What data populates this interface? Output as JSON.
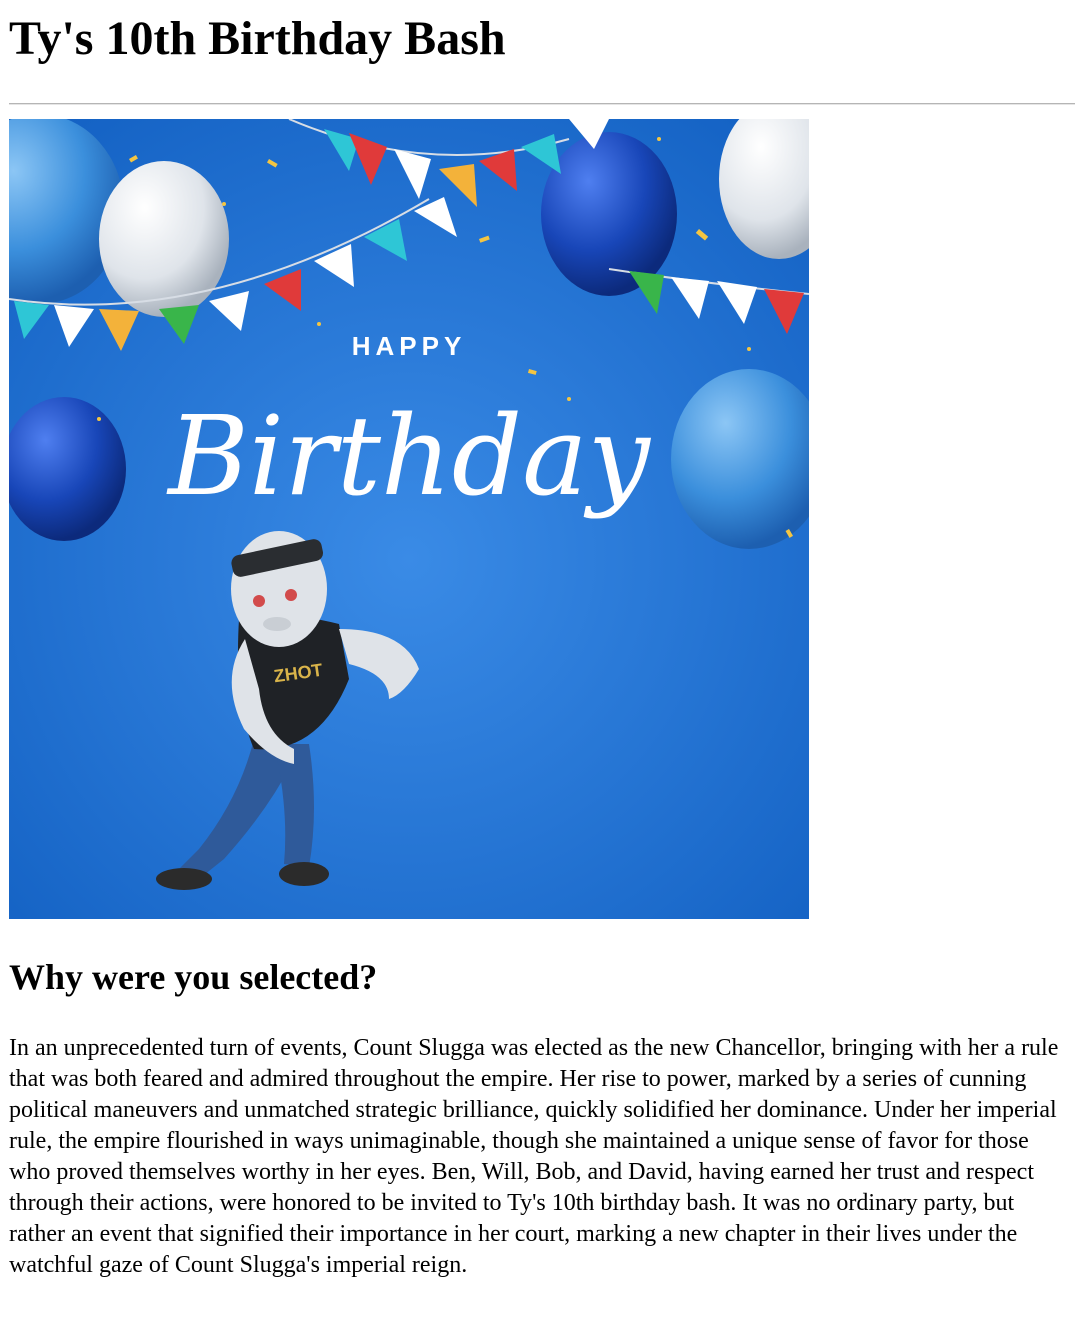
{
  "page": {
    "title": "Ty's 10th Birthday Bash",
    "section_heading": "Why were you selected?",
    "body_text": "In an unprecedented turn of events, Count Slugga was elected as the new Chancellor, bringing with her a rule that was both feared and admired throughout the empire. Her rise to power, marked by a series of cunning political maneuvers and unmatched strategic brilliance, quickly solidified her dominance. Under her imperial rule, the empire flourished in ways unimaginable, though she maintained a unique sense of favor for those who proved themselves worthy in her eyes. Ben, Will, Bob, and David, having earned her trust and respect through their actions, were honored to be invited to Ty's 10th birthday bash. It was no ordinary party, but rather an event that signified their importance in her court, marking a new chapter in their lives under the watchful gaze of Count Slugga's imperial reign."
  },
  "banner": {
    "happy_text": "HAPPY",
    "birthday_text": "Birthday",
    "shirt_text": "ZHOT",
    "colors": {
      "background": "#1d6fce",
      "balloon_blue": "#1846b8",
      "balloon_white": "#e9edf2",
      "flag_red": "#e03a3a",
      "flag_teal": "#2ec6d6",
      "flag_yellow": "#f3b23a",
      "flag_green": "#39b54a"
    }
  }
}
